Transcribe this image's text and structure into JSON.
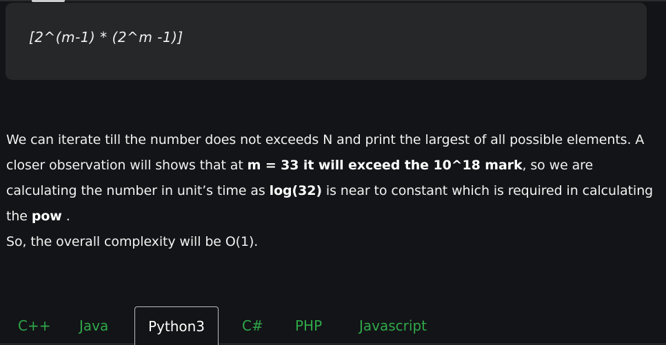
{
  "formula": {
    "text": "[2^(m-1) * (2^m -1)]"
  },
  "explanation": {
    "p1_a": "We can iterate till the number does not exceeds N and print the largest of all possible elements. A closer observation will shows that at ",
    "p1_bold1": "m = 33 it will exceed the 10^18 mark",
    "p1_b": ", so we are calculating the number in unit’s time as ",
    "p1_bold2": "log(32)",
    "p1_c": " is near to constant which is required in calculating the ",
    "p1_bold3": "pow",
    "p1_d": " .",
    "p2": "So, the overall complexity will be O(1)."
  },
  "tabs": {
    "items": [
      {
        "label": "C++"
      },
      {
        "label": "Java"
      },
      {
        "label": "Python3"
      },
      {
        "label": "C#"
      },
      {
        "label": "PHP"
      },
      {
        "label": "Javascript"
      }
    ],
    "active_index": 2
  },
  "colors": {
    "background": "#131417",
    "code_box": "#262729",
    "tab_inactive": "#2fa84a",
    "tab_active_text": "#ffffff"
  }
}
